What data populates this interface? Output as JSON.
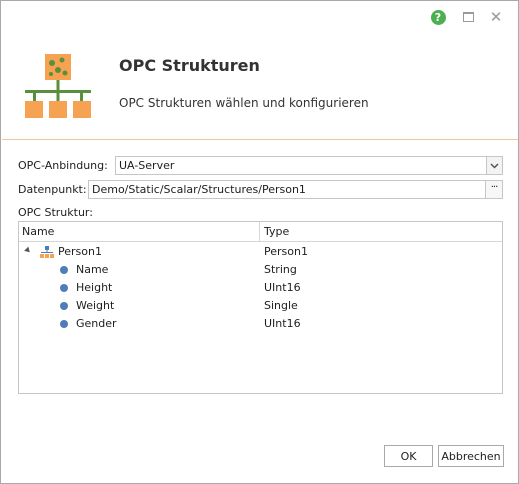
{
  "header": {
    "title": "OPC Strukturen",
    "subtitle": "OPC Strukturen wählen und konfigurieren"
  },
  "titlebar": {
    "help_glyph": "?",
    "close_glyph": "✕"
  },
  "form": {
    "connection_label": "OPC-Anbindung:",
    "connection_value": "UA-Server",
    "datapoint_label": "Datenpunkt:",
    "datapoint_value": "Demo/Static/Scalar/Structures/Person1",
    "browse_glyph": "···",
    "structure_label": "OPC Struktur:"
  },
  "tree": {
    "columns": {
      "name": "Name",
      "type": "Type"
    },
    "root": {
      "name": "Person1",
      "type": "Person1"
    },
    "children": [
      {
        "name": "Name",
        "type": "String"
      },
      {
        "name": "Height",
        "type": "UInt16"
      },
      {
        "name": "Weight",
        "type": "Single"
      },
      {
        "name": "Gender",
        "type": "UInt16"
      }
    ]
  },
  "buttons": {
    "ok": "OK",
    "cancel": "Abbrechen"
  },
  "colors": {
    "accent_orange": "#f5a253",
    "logo_green": "#5a8f3c",
    "dot_blue": "#4f7db8",
    "help_green": "#4caf50"
  }
}
